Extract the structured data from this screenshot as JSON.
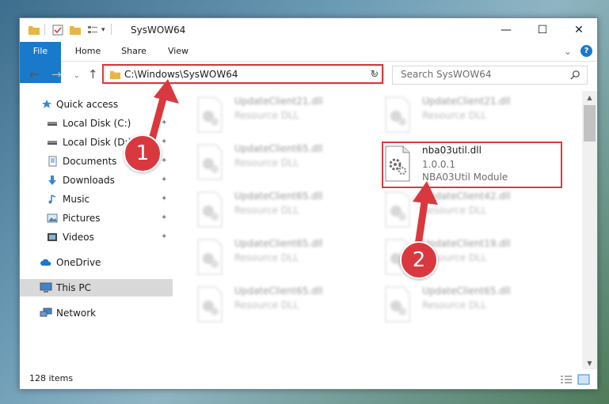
{
  "window": {
    "title": "SysWOW64",
    "minimize_glyph": "—",
    "maximize_glyph": "☐",
    "close_glyph": "✕"
  },
  "ribbon": {
    "tabs": [
      "File",
      "Home",
      "Share",
      "View"
    ],
    "collapse_glyph": "⌄",
    "help_glyph": "?"
  },
  "address": {
    "path": "C:\\Windows\\SysWOW64",
    "dropdown_glyph": "⌄",
    "refresh_glyph": "↻"
  },
  "search": {
    "placeholder": "Search SysWOW64",
    "icon": "search-icon"
  },
  "nav": {
    "items": [
      {
        "label": "Quick access",
        "icon": "star-icon",
        "pinned": false
      },
      {
        "label": "Local Disk (C:)",
        "icon": "drive-icon",
        "pinned": true
      },
      {
        "label": "Local Disk (D:)",
        "icon": "drive-icon",
        "pinned": true
      },
      {
        "label": "Documents",
        "icon": "documents-icon",
        "pinned": true
      },
      {
        "label": "Downloads",
        "icon": "download-icon",
        "pinned": true
      },
      {
        "label": "Music",
        "icon": "music-icon",
        "pinned": true
      },
      {
        "label": "Pictures",
        "icon": "pictures-icon",
        "pinned": true
      },
      {
        "label": "Videos",
        "icon": "videos-icon",
        "pinned": true
      },
      {
        "label": "OneDrive",
        "icon": "cloud-icon",
        "pinned": false
      },
      {
        "label": "This PC",
        "icon": "computer-icon",
        "pinned": false,
        "selected": true
      },
      {
        "label": "Network",
        "icon": "network-icon",
        "pinned": false
      }
    ],
    "pin_glyph": "✦"
  },
  "files": [
    {
      "name": "UpdateClient21.dll",
      "line2": "Resource DLL"
    },
    {
      "name": "UpdateClient21.dll",
      "line2": "Resource DLL"
    },
    {
      "name": "UpdateClient65.dll",
      "line2": "Resource DLL"
    },
    {
      "name": "nba03util.dll",
      "line2": "1.0.0.1",
      "line3": "NBA03Util Module",
      "highlighted": true
    },
    {
      "name": "UpdateClient65.dll",
      "line2": "Resource DLL"
    },
    {
      "name": "UpdateClient42.dll",
      "line2": "Resource DLL"
    },
    {
      "name": "UpdateClient65.dll",
      "line2": "Resource DLL"
    },
    {
      "name": "UpdateClient19.dll",
      "line2": "Resource DLL"
    },
    {
      "name": "UpdateClient65.dll",
      "line2": "Resource DLL"
    },
    {
      "name": "UpdateClient65.dll",
      "line2": "Resource DLL"
    }
  ],
  "status": {
    "item_count": "128 items"
  },
  "annotations": {
    "badge1": "1",
    "badge2": "2"
  },
  "colors": {
    "accent": "#1979ca",
    "highlight": "#d9393e"
  }
}
